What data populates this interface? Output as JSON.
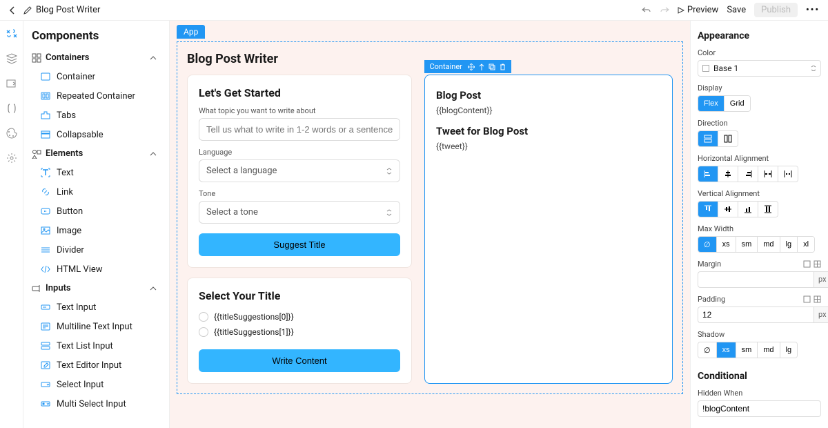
{
  "topbar": {
    "title": "Blog Post Writer",
    "preview": "Preview",
    "save": "Save",
    "publish": "Publish"
  },
  "leftPanel": {
    "title": "Components",
    "sections": {
      "containers": {
        "label": "Containers",
        "items": [
          "Container",
          "Repeated Container",
          "Tabs",
          "Collapsable"
        ]
      },
      "elements": {
        "label": "Elements",
        "items": [
          "Text",
          "Link",
          "Button",
          "Image",
          "Divider",
          "HTML View"
        ]
      },
      "inputs": {
        "label": "Inputs",
        "items": [
          "Text Input",
          "Multiline Text Input",
          "Text List Input",
          "Text Editor Input",
          "Select Input",
          "Multi Select Input"
        ]
      }
    }
  },
  "canvas": {
    "appChip": "App",
    "title": "Blog Post Writer",
    "leftCard1": {
      "heading": "Let's Get Started",
      "topicLabel": "What topic you want to write about",
      "topicPlaceholder": "Tell us what to write in 1-2 words or a sentence",
      "languageLabel": "Language",
      "languagePlaceholder": "Select a language",
      "toneLabel": "Tone",
      "tonePlaceholder": "Select a tone",
      "suggestBtn": "Suggest Title"
    },
    "leftCard2": {
      "heading": "Select Your Title",
      "options": [
        "{{titleSuggestions[0]}}",
        "{{titleSuggestions[1]}}"
      ],
      "writeBtn": "Write Content"
    },
    "rightCard": {
      "chip": "Container",
      "blogHeading": "Blog Post",
      "blogContent": "{{blogContent}}",
      "tweetHeading": "Tweet for Blog Post",
      "tweetContent": "{{tweet}}"
    }
  },
  "rightPanel": {
    "appearance": "Appearance",
    "colorLabel": "Color",
    "colorValue": "Base 1",
    "displayLabel": "Display",
    "displayOptions": [
      "Flex",
      "Grid"
    ],
    "directionLabel": "Direction",
    "hAlignLabel": "Horizontal Alignment",
    "vAlignLabel": "Vertical Alignment",
    "maxWidthLabel": "Max Width",
    "maxWidthOptions": [
      "∅",
      "xs",
      "sm",
      "md",
      "lg",
      "xl"
    ],
    "marginLabel": "Margin",
    "marginValue": "",
    "paddingLabel": "Padding",
    "paddingValue": "12",
    "unit": "px",
    "shadowLabel": "Shadow",
    "shadowOptions": [
      "∅",
      "xs",
      "sm",
      "md",
      "lg"
    ],
    "conditionalLabel": "Conditional",
    "hiddenWhenLabel": "Hidden When",
    "hiddenWhenValue": "!blogContent"
  }
}
